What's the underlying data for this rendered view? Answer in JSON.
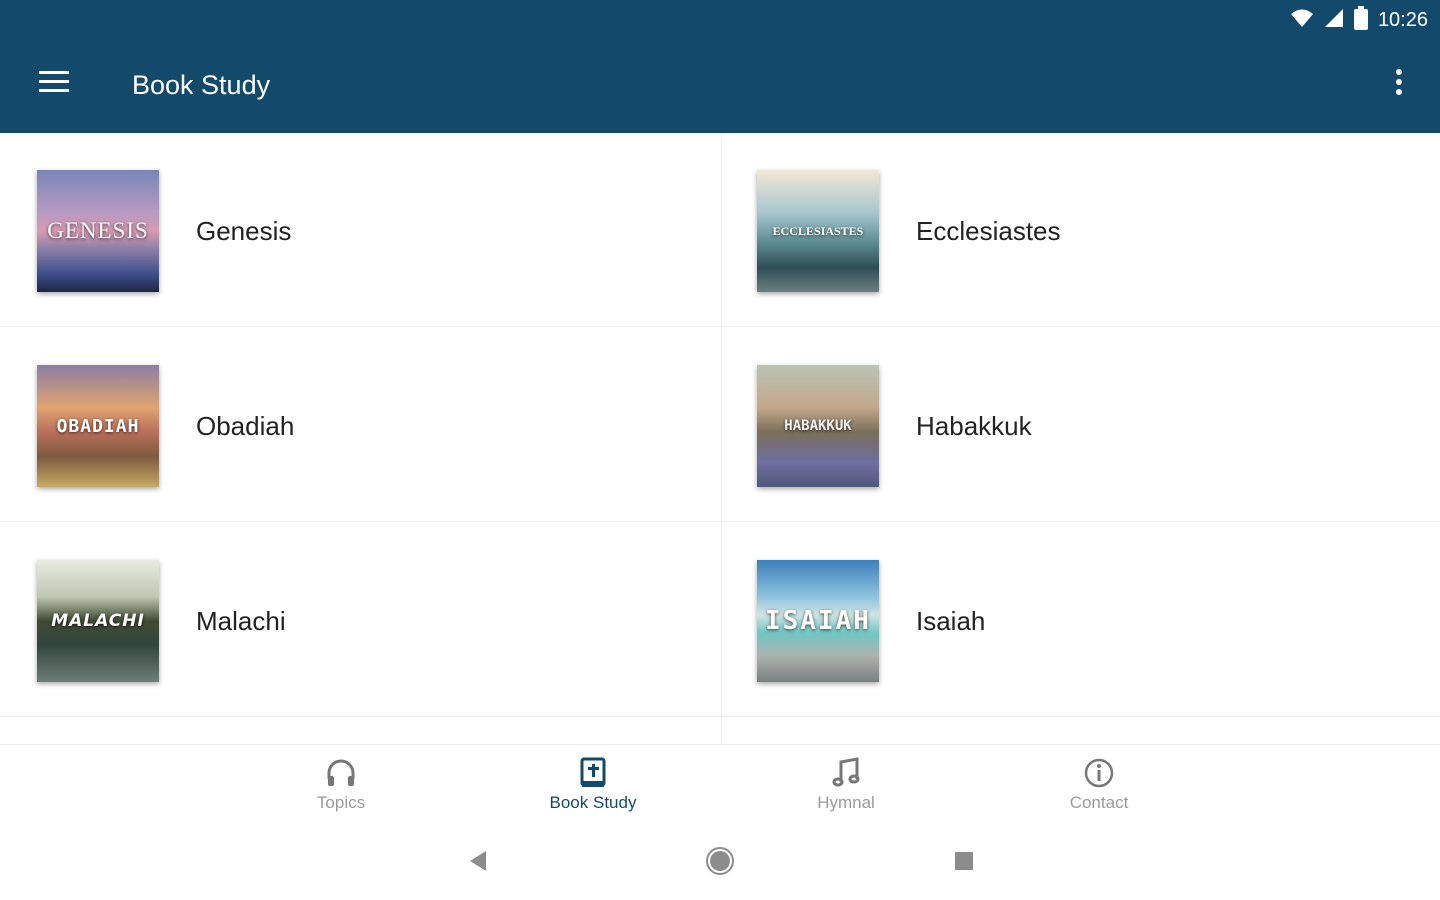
{
  "statusbar": {
    "time": "10:26"
  },
  "appbar": {
    "title": "Book Study"
  },
  "books": [
    {
      "label": "Genesis",
      "thumb_text": "GENESIS"
    },
    {
      "label": "Ecclesiastes",
      "thumb_text": "ECCLESIASTES"
    },
    {
      "label": "Obadiah",
      "thumb_text": "OBADIAH"
    },
    {
      "label": "Habakkuk",
      "thumb_text": "HABAKKUK"
    },
    {
      "label": "Malachi",
      "thumb_text": "MALACHI"
    },
    {
      "label": "Isaiah",
      "thumb_text": "ISAIAH"
    }
  ],
  "bottom_nav": {
    "active": "Book Study",
    "items": [
      {
        "label": "Topics",
        "icon": "headphones-icon"
      },
      {
        "label": "Book Study",
        "icon": "bible-icon"
      },
      {
        "label": "Hymnal",
        "icon": "music-note-icon"
      },
      {
        "label": "Contact",
        "icon": "info-icon"
      }
    ]
  },
  "colors": {
    "primary": "#134a6b",
    "nav_inactive": "#9a9a9a",
    "text": "#222222"
  }
}
